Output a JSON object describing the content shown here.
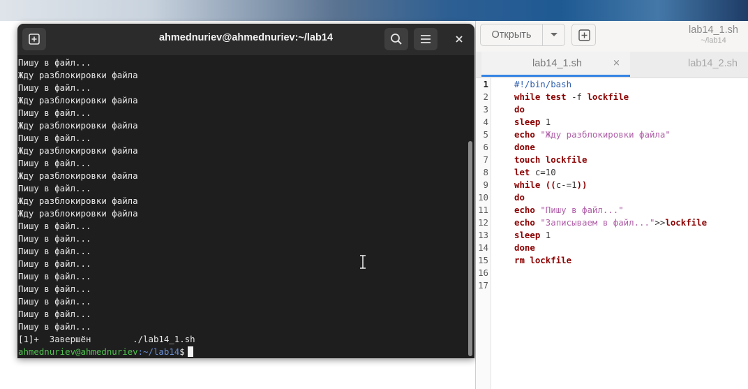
{
  "terminal": {
    "title": "ahmednuriev@ahmednuriev:~/lab14",
    "output_lines": [
      "Пишу в файл...",
      "Жду разблокировки файла",
      "Пишу в файл...",
      "Жду разблокировки файла",
      "Пишу в файл...",
      "Жду разблокировки файла",
      "Пишу в файл...",
      "Жду разблокировки файла",
      "Пишу в файл...",
      "Жду разблокировки файла",
      "Пишу в файл...",
      "Жду разблокировки файла",
      "Жду разблокировки файла",
      "Пишу в файл...",
      "Пишу в файл...",
      "Пишу в файл...",
      "Пишу в файл...",
      "Пишу в файл...",
      "Пишу в файл...",
      "Пишу в файл...",
      "Пишу в файл...",
      "Пишу в файл...",
      "[1]+  Завершён        ./lab14_1.sh"
    ],
    "prompt_user": "ahmednuriev@ahmednuriev",
    "prompt_path": ":~/lab14",
    "prompt_symbol": "$",
    "icons": {
      "new_tab": "new-tab-icon",
      "search": "search-icon",
      "menu": "hamburger-menu-icon",
      "close": "close-icon"
    }
  },
  "editor": {
    "open_label": "Открыть",
    "title": "lab14_1.sh",
    "subtitle": "~/lab14",
    "tabs": [
      {
        "label": "lab14_1.sh",
        "active": true,
        "close": "×"
      },
      {
        "label": "lab14_2.sh",
        "active": false
      }
    ],
    "line_numbers": [
      "1",
      "2",
      "3",
      "4",
      "5",
      "6",
      "7",
      "8",
      "9",
      "10",
      "11",
      "12",
      "13",
      "14",
      "15",
      "16",
      "17"
    ],
    "current_line": 1,
    "code": [
      [
        {
          "t": "#!/bin/bash",
          "c": "cmt"
        }
      ],
      [
        {
          "t": "while test",
          "c": "kw"
        },
        {
          "t": " -f ",
          "c": ""
        },
        {
          "t": "lockfile",
          "c": "kw"
        }
      ],
      [
        {
          "t": "do",
          "c": "kw"
        }
      ],
      [
        {
          "t": "sleep",
          "c": "kw"
        },
        {
          "t": " 1",
          "c": ""
        }
      ],
      [
        {
          "t": "echo",
          "c": "kw"
        },
        {
          "t": " ",
          "c": ""
        },
        {
          "t": "\"Жду разблокировки файла\"",
          "c": "str"
        }
      ],
      [
        {
          "t": "done",
          "c": "kw"
        }
      ],
      [
        {
          "t": "touch lockfile",
          "c": "kw"
        }
      ],
      [
        {
          "t": "let",
          "c": "kw"
        },
        {
          "t": " c=10",
          "c": ""
        }
      ],
      [
        {
          "t": "while",
          "c": "kw"
        },
        {
          "t": " ",
          "c": ""
        },
        {
          "t": "((",
          "c": "kw"
        },
        {
          "t": "c-=1",
          "c": ""
        },
        {
          "t": "))",
          "c": "kw"
        }
      ],
      [
        {
          "t": "do",
          "c": "kw"
        }
      ],
      [
        {
          "t": "echo",
          "c": "kw"
        },
        {
          "t": " ",
          "c": ""
        },
        {
          "t": "\"Пишу в файл...\"",
          "c": "str"
        }
      ],
      [
        {
          "t": "echo",
          "c": "kw"
        },
        {
          "t": " ",
          "c": ""
        },
        {
          "t": "\"Записываем в файл...\"",
          "c": "str"
        },
        {
          "t": ">>",
          "c": ""
        },
        {
          "t": "lockfile",
          "c": "kw"
        }
      ],
      [
        {
          "t": "sleep",
          "c": "kw"
        },
        {
          "t": " 1",
          "c": ""
        }
      ],
      [
        {
          "t": "done",
          "c": "kw"
        }
      ],
      [
        {
          "t": "rm lockfile",
          "c": "kw"
        }
      ],
      [],
      []
    ],
    "icons": {
      "dropdown": "chevron-down-icon",
      "new_document": "new-document-icon"
    }
  },
  "colors": {
    "terminal_bg": "#1e1e1e",
    "prompt_user": "#4ec24e",
    "prompt_path": "#6b8fd6",
    "keyword": "#8b0000",
    "string": "#b060a8",
    "comment": "#2f5fb0",
    "tab_accent": "#3584e4"
  }
}
